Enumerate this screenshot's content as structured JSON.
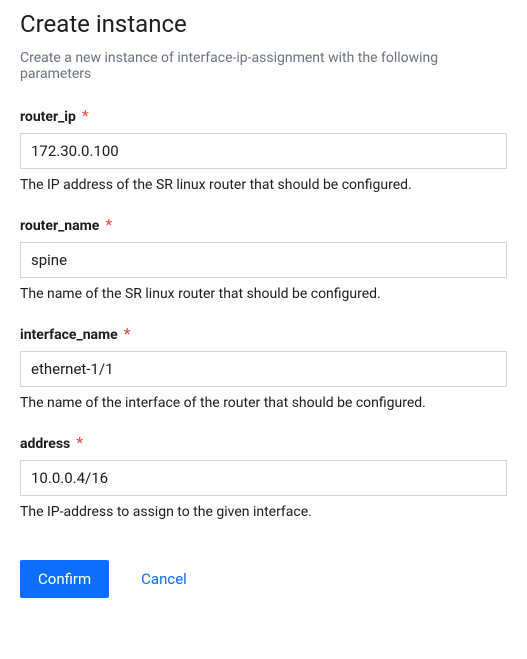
{
  "header": {
    "title": "Create instance",
    "subtitle": "Create a new instance of interface-ip-assignment with the following parameters"
  },
  "required_mark": "*",
  "fields": [
    {
      "label": "router_ip",
      "value": "172.30.0.100",
      "hint": "The IP address of the SR linux router that should be configured."
    },
    {
      "label": "router_name",
      "value": "spine",
      "hint": "The name of the SR linux router that should be configured."
    },
    {
      "label": "interface_name",
      "value": "ethernet-1/1",
      "hint": "The name of the interface of the router that should be configured."
    },
    {
      "label": "address",
      "value": "10.0.0.4/16",
      "hint": "The IP-address to assign to the given interface."
    }
  ],
  "actions": {
    "confirm": "Confirm",
    "cancel": "Cancel"
  }
}
